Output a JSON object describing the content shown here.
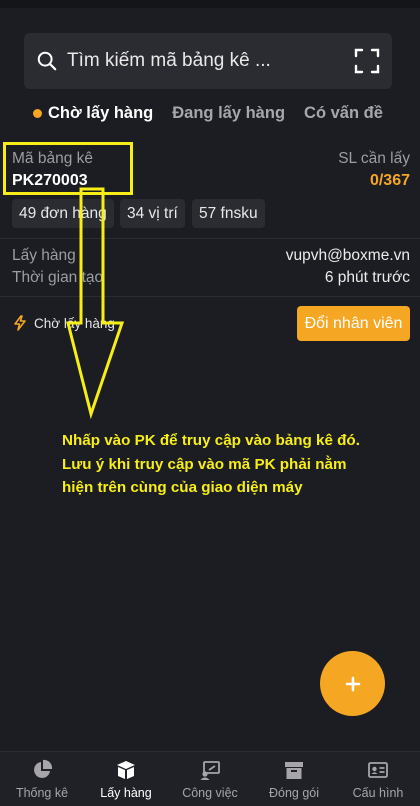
{
  "search": {
    "placeholder": "Tìm kiếm mã bảng kê ..."
  },
  "tabs": [
    {
      "label": "Chờ lấy hàng",
      "active": true
    },
    {
      "label": "Đang lấy hàng",
      "active": false
    },
    {
      "label": "Có vấn đề",
      "active": false
    }
  ],
  "card": {
    "code_label": "Mã bảng kê",
    "code_value": "PK270003",
    "sl_label": "SL cần lấy",
    "sl_value": "0/367",
    "chips": [
      "49 đơn hàng",
      "34 vị trí",
      "57 fnsku"
    ],
    "picker_label": "Lấy hàng",
    "picker_value": "vupvh@boxme.vn",
    "time_label": "Thời gian tạo",
    "time_value": "6 phút trước",
    "status_text": "Chờ lấy hàng",
    "change_button": "Đổi nhân viên"
  },
  "annotation": "Nhấp vào PK để truy cập vào bảng kê đó. Lưu ý khi truy cập vào mã PK phải nằm hiện trên cùng của giao diện máy",
  "fab_symbol": "+",
  "bottom_nav": [
    {
      "label": "Thống kê",
      "icon": "pie-chart-icon",
      "active": false
    },
    {
      "label": "Lấy hàng",
      "icon": "box-open-icon",
      "active": true
    },
    {
      "label": "Công việc",
      "icon": "task-board-icon",
      "active": false
    },
    {
      "label": "Đóng gói",
      "icon": "package-icon",
      "active": false
    },
    {
      "label": "Cấu hình",
      "icon": "id-card-icon",
      "active": false
    }
  ],
  "colors": {
    "accent": "#f5a623",
    "highlight": "#f6ee16",
    "background": "#1c1d22"
  }
}
